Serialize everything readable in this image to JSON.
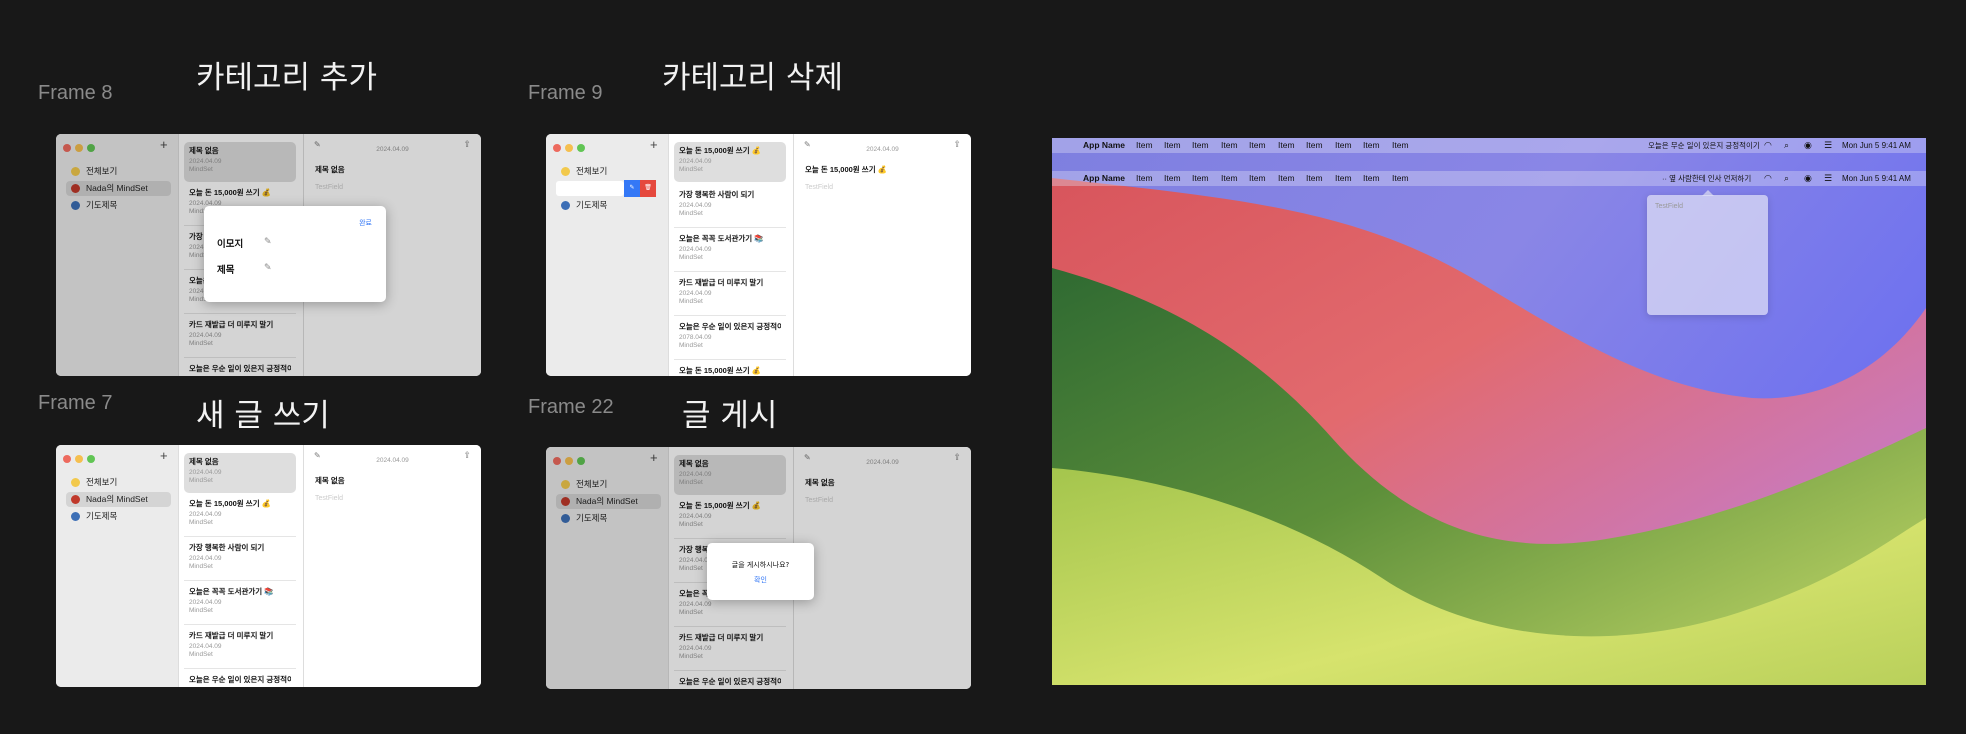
{
  "frames": {
    "f8": {
      "label": "Frame 8",
      "title": "카테고리 추가"
    },
    "f9": {
      "label": "Frame 9",
      "title": "카테고리 삭제"
    },
    "f7": {
      "label": "Frame 7",
      "title": "새 글 쓰기"
    },
    "f22": {
      "label": "Frame 22",
      "title": "글 게시"
    }
  },
  "sidebar": {
    "all": "전체보기",
    "nada": "Nada의 MindSet",
    "pray": "기도제목"
  },
  "list": {
    "date": "2024.04.09",
    "date_alt": "2078.04.09",
    "category": "MindSet",
    "items": [
      "제목 없음",
      "오늘 돈 15,000원 쓰기 💰",
      "가장 행복한 사람이 되기",
      "오늘은 꼭꼭 도서관가기 📚",
      "카드 재발급 더 미루지 말기",
      "오늘은 우순 일이 있은지 긍정적이기"
    ]
  },
  "detail": {
    "date": "2024.04.09",
    "title": "제목 없음",
    "title_f9": "오늘 돈 15,000원 쓰기 💰",
    "field": "TestField"
  },
  "sheet_add": {
    "done": "완료",
    "emoji": "이모지",
    "title": "제목"
  },
  "alert": {
    "message": "글을 게시하시나요?",
    "confirm": "확인"
  },
  "desktop": {
    "app_name": "App Name",
    "menu_items": [
      "Item",
      "Item",
      "Item",
      "Item",
      "Item",
      "Item",
      "Item",
      "Item",
      "Item",
      "Item"
    ],
    "status_1": "오늘은 무순 일이 있은지 긍정적이기",
    "status_2": "·· 옆 사람한테 인사 먼저하기",
    "clock": "Mon Jun 5  9:41 AM",
    "popover_field": "TestField"
  }
}
